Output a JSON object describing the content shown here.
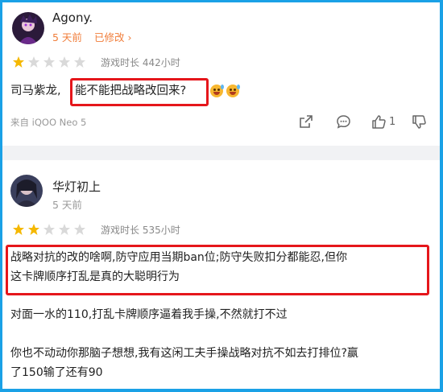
{
  "comments": [
    {
      "username": "Agony.",
      "time": "5 天前",
      "edited": "已修改 ›",
      "rating": 1,
      "playtime": "游戏时长 442小时",
      "text_prefix": "司马紫龙,",
      "text_highlight": "能不能把战略改回来?",
      "device": "来自 iQOO Neo 5",
      "like_count": "1"
    },
    {
      "username": "华灯初上",
      "time": "5 天前",
      "rating": 2,
      "playtime": "游戏时长 535小时",
      "highlight_line1": "战略对抗的改的啥啊,防守应用当期ban位;防守失败扣分都能忍,但你",
      "highlight_line2": "这卡牌顺序打乱是真的大聪明行为",
      "paragraph2": "对面一水的110,打乱卡牌顺序逼着我手操,不然就打不过",
      "paragraph3_line1": "你也不动动你那脑子想想,我有这闲工夫手操战略对抗不如去打排位?赢",
      "paragraph3_line2": "了150输了还有90"
    }
  ],
  "colors": {
    "accent": "#f07d3a",
    "star_on": "#f5b800",
    "star_off": "#d9d9d9",
    "highlight_border": "#e5161b",
    "frame": "#1aa1e6"
  }
}
